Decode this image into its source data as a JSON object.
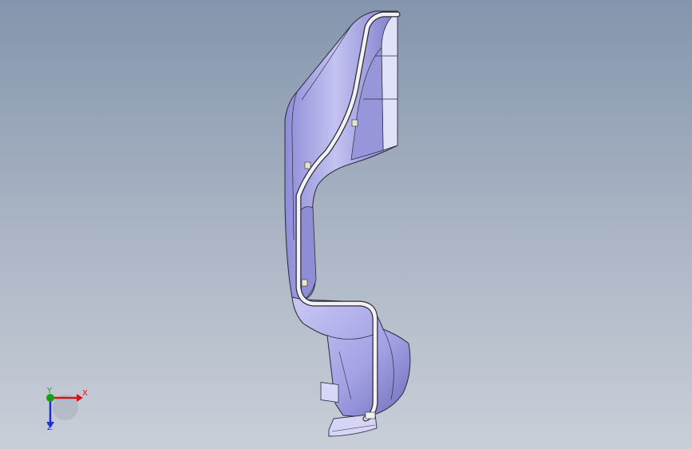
{
  "viewport": {
    "background_top": "#8495ad",
    "background_bottom": "#c9cfd8"
  },
  "model": {
    "body_color": "#b6b4ee",
    "shade_color": "#7a78c4",
    "highlight_color": "#e6e6fb",
    "edge_color": "#2b2b3a",
    "tube_color": "#f2f2f4"
  },
  "triad": {
    "x_label": "X",
    "y_label": "Y",
    "z_label": "Z",
    "x_color": "#d01818",
    "y_color": "#18a018",
    "z_color": "#1e2ed0"
  }
}
